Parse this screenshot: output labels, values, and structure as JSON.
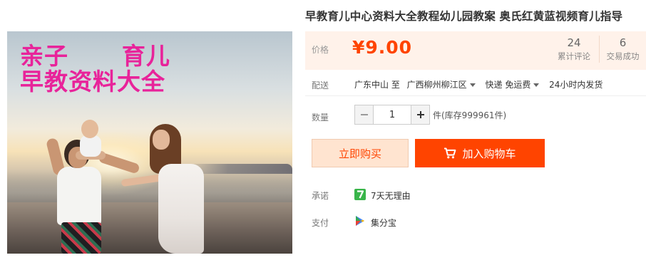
{
  "image": {
    "overlay_line1": "亲子      育儿",
    "overlay_line2": "早教资料大全"
  },
  "product": {
    "title": "早教育儿中心资料大全教程幼儿园教案 奥氏红黄蓝视频育儿指导"
  },
  "price": {
    "label": "价格",
    "value": "¥9.00"
  },
  "stats": {
    "reviews_count": "24",
    "reviews_label": "累计评论",
    "sold_count": "6",
    "sold_label": "交易成功"
  },
  "shipping": {
    "label": "配送",
    "from": "广东中山 至",
    "to": "广西柳州柳江区",
    "method": "快递 免运费",
    "dispatch": "24小时内发货"
  },
  "quantity": {
    "label": "数量",
    "value": "1",
    "unit_stock": "件(库存999961件)"
  },
  "actions": {
    "buy_now": "立即购买",
    "add_to_cart": "加入购物车"
  },
  "promise": {
    "label": "承诺",
    "text": "7天无理由"
  },
  "payment": {
    "label": "支付",
    "text": "集分宝"
  },
  "colors": {
    "accent": "#ff4400",
    "price_bg": "#fff2ea",
    "photo_text": "#e8239a"
  }
}
